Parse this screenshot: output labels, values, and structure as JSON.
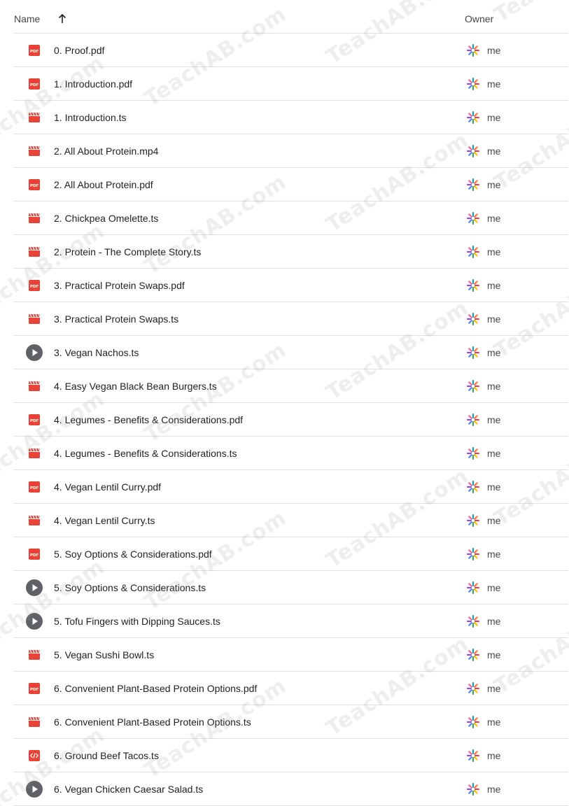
{
  "header": {
    "name_label": "Name",
    "owner_label": "Owner",
    "sort_icon": "arrow-up-icon"
  },
  "colors": {
    "pdf": "#ea4335",
    "video": "#ea4335",
    "code": "#ea4335",
    "play": "#5f6368",
    "divider": "#e0e0e0"
  },
  "files": [
    {
      "name": "0. Proof.pdf",
      "type": "pdf",
      "owner": "me"
    },
    {
      "name": "1. Introduction.pdf",
      "type": "pdf",
      "owner": "me"
    },
    {
      "name": "1. Introduction.ts",
      "type": "video",
      "owner": "me"
    },
    {
      "name": "2. All About Protein.mp4",
      "type": "video",
      "owner": "me"
    },
    {
      "name": "2. All About Protein.pdf",
      "type": "pdf",
      "owner": "me"
    },
    {
      "name": "2. Chickpea Omelette.ts",
      "type": "video",
      "owner": "me"
    },
    {
      "name": "2. Protein - The Complete Story.ts",
      "type": "video",
      "owner": "me"
    },
    {
      "name": "3. Practical Protein Swaps.pdf",
      "type": "pdf",
      "owner": "me"
    },
    {
      "name": "3. Practical Protein Swaps.ts",
      "type": "video",
      "owner": "me"
    },
    {
      "name": "3. Vegan Nachos.ts",
      "type": "play",
      "owner": "me"
    },
    {
      "name": "4. Easy Vegan Black Bean Burgers.ts",
      "type": "video",
      "owner": "me"
    },
    {
      "name": "4. Legumes - Benefits & Considerations.pdf",
      "type": "pdf",
      "owner": "me"
    },
    {
      "name": "4. Legumes - Benefits & Considerations.ts",
      "type": "video",
      "owner": "me"
    },
    {
      "name": "4. Vegan Lentil Curry.pdf",
      "type": "pdf",
      "owner": "me"
    },
    {
      "name": "4. Vegan Lentil Curry.ts",
      "type": "video",
      "owner": "me"
    },
    {
      "name": "5. Soy Options & Considerations.pdf",
      "type": "pdf",
      "owner": "me"
    },
    {
      "name": "5. Soy Options & Considerations.ts",
      "type": "play",
      "owner": "me"
    },
    {
      "name": "5. Tofu Fingers with Dipping Sauces.ts",
      "type": "play",
      "owner": "me"
    },
    {
      "name": "5. Vegan Sushi Bowl.ts",
      "type": "video",
      "owner": "me"
    },
    {
      "name": "6. Convenient Plant-Based Protein Options.pdf",
      "type": "pdf",
      "owner": "me"
    },
    {
      "name": "6. Convenient Plant-Based Protein Options.ts",
      "type": "video",
      "owner": "me"
    },
    {
      "name": "6. Ground Beef Tacos.ts",
      "type": "code",
      "owner": "me"
    },
    {
      "name": "6. Vegan Chicken Caesar Salad.ts",
      "type": "play",
      "owner": "me"
    }
  ],
  "watermark": "TeachAB.com"
}
